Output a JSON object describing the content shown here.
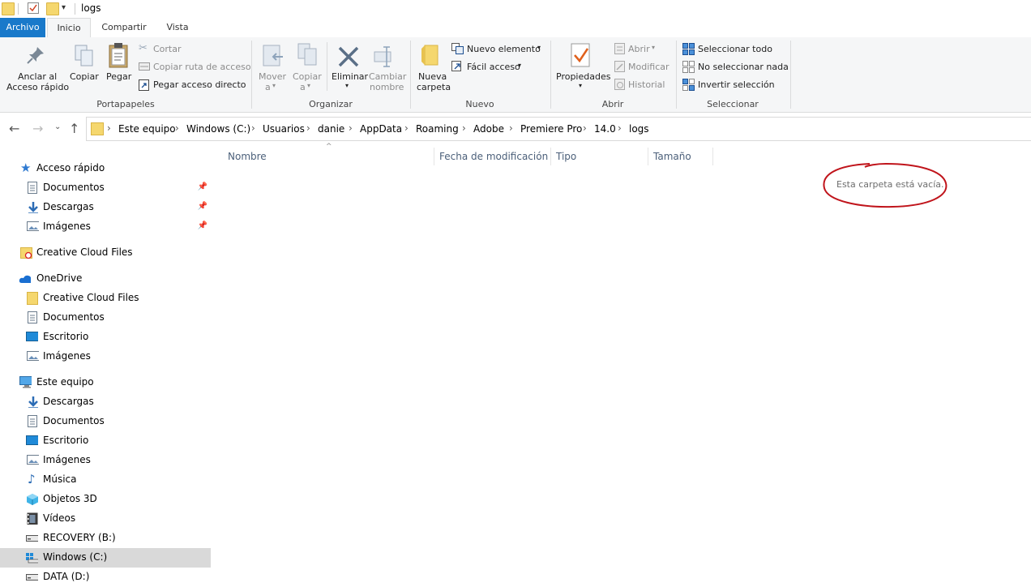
{
  "window": {
    "title": "logs"
  },
  "tabs": [
    "Archivo",
    "Inicio",
    "Compartir",
    "Vista"
  ],
  "ribbon": {
    "portapapeles": {
      "pin_label_1": "Anclar al",
      "pin_label_2": "Acceso rápido",
      "copy": "Copiar",
      "paste": "Pegar",
      "cut": "Cortar",
      "copy_path": "Copiar ruta de acceso",
      "paste_shortcut": "Pegar acceso directo",
      "group": "Portapapeles"
    },
    "organizar": {
      "move_1": "Mover",
      "move_2": "a",
      "copyto_1": "Copiar",
      "copyto_2": "a",
      "delete": "Eliminar",
      "rename_1": "Cambiar",
      "rename_2": "nombre",
      "group": "Organizar"
    },
    "nuevo": {
      "new_folder_1": "Nueva",
      "new_folder_2": "carpeta",
      "new_item": "Nuevo elemento",
      "easy_access": "Fácil acceso",
      "group": "Nuevo"
    },
    "abrir": {
      "properties": "Propiedades",
      "open": "Abrir",
      "edit": "Modificar",
      "history": "Historial",
      "group": "Abrir"
    },
    "seleccionar": {
      "select_all": "Seleccionar todo",
      "select_none": "No seleccionar nada",
      "invert": "Invertir selección",
      "group": "Seleccionar"
    }
  },
  "breadcrumb": [
    "Este equipo",
    "Windows (C:)",
    "Usuarios",
    "danie",
    "AppData",
    "Roaming",
    "Adobe",
    "Premiere Pro",
    "14.0",
    "logs"
  ],
  "sidebar": {
    "quick_access": "Acceso rápido",
    "qa_items": [
      "Documentos",
      "Descargas",
      "Imágenes"
    ],
    "creative_cloud": "Creative Cloud Files",
    "onedrive": "OneDrive",
    "od_items": [
      "Creative Cloud Files",
      "Documentos",
      "Escritorio",
      "Imágenes"
    ],
    "this_pc": "Este equipo",
    "pc_items": [
      "Descargas",
      "Documentos",
      "Escritorio",
      "Imágenes",
      "Música",
      "Objetos 3D",
      "Vídeos",
      "RECOVERY (B:)",
      "Windows (C:)",
      "DATA (D:)"
    ]
  },
  "columns": [
    "Nombre",
    "Fecha de modificación",
    "Tipo",
    "Tamaño"
  ],
  "empty_message": "Esta carpeta está vacía.",
  "colors": {
    "accent": "#1979ca",
    "selected": "#d9d9d9",
    "annotation": "#c0141b"
  }
}
